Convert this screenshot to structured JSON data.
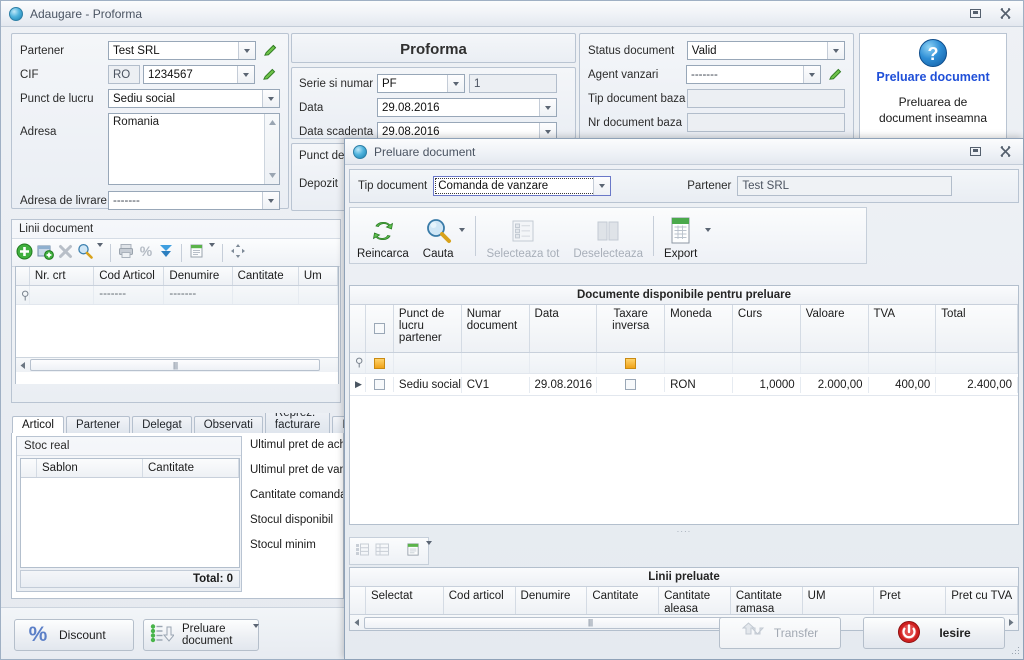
{
  "bg_window": {
    "title": "Adaugare - Proforma",
    "window_icon": "app-globe-icon",
    "restore_label": "restore-icon",
    "close_label": "close-icon",
    "partner_panel": {
      "fields": [
        {
          "label": "Partener",
          "value": "Test SRL",
          "type": "combo-edit"
        },
        {
          "label": "CIF",
          "prefix": "RO",
          "value": "1234567",
          "type": "combo-edit"
        },
        {
          "label": "Punct de lucru",
          "value": "Sediu social",
          "type": "combo"
        },
        {
          "label": "Adresa",
          "value": "Romania",
          "type": "textarea"
        },
        {
          "label": "Adresa de livrare",
          "value": "-------",
          "type": "combo"
        }
      ]
    },
    "doc_panel": {
      "title": "Proforma",
      "fields": [
        {
          "label": "Serie si numar",
          "value": "PF",
          "value2": "1",
          "type": "combo-plus-text"
        },
        {
          "label": "Data",
          "value": "29.08.2016",
          "type": "combo"
        },
        {
          "label": "Data scadenta",
          "value": "29.08.2016",
          "type": "combo"
        }
      ],
      "partial_fields": [
        {
          "label": "Punct de"
        },
        {
          "label": "Depozit"
        }
      ]
    },
    "status_panel": {
      "fields": [
        {
          "label": "Status document",
          "value": "Valid",
          "type": "combo"
        },
        {
          "label": "Agent vanzari",
          "value": "-------",
          "type": "combo-edit"
        },
        {
          "label": "Tip document baza",
          "value": "",
          "type": "readonly"
        },
        {
          "label": "Nr document baza",
          "value": "",
          "type": "readonly"
        }
      ]
    },
    "help_panel": {
      "icon": "question-mark-icon",
      "heading": "Preluare document",
      "body_line1": "Preluarea de",
      "body_line2": "document inseamna"
    },
    "lines_panel": {
      "caption": "Linii document",
      "toolbar_icons": [
        "add-icon",
        "add-from-icon",
        "delete-icon",
        "search-icon",
        "search-dropdown-caret",
        "print-icon",
        "percent-discount-icon",
        "collapse-icon",
        "report-icon",
        "report-dropdown-caret",
        "move-icon"
      ],
      "columns": [
        "Nr. crt",
        "Cod Articol",
        "Denumire",
        "Cantitate",
        "Um"
      ],
      "filter_row": [
        "",
        "-------",
        "-------",
        "",
        ""
      ],
      "scroll_thumb_glyph": "||||"
    },
    "detail_tabs": {
      "items": [
        "Articol",
        "Partener",
        "Delegat",
        "Observati",
        "Reprez. facturare",
        "In"
      ],
      "active": "Articol"
    },
    "stock_panel": {
      "caption": "Stoc real",
      "columns": [
        "Sablon",
        "Cantitate"
      ],
      "total_label": "Total: 0"
    },
    "stock_info_labels": [
      "Ultimul pret de achi:",
      "Ultimul pret de vanz",
      "Cantitate comanda",
      "Stocul disponibil",
      "Stocul minim"
    ],
    "footer_buttons": [
      {
        "label": "Discount",
        "icon": "percent-icon"
      },
      {
        "label": "Preluare document",
        "icon": "import-document-icon",
        "has_dropdown": true
      }
    ]
  },
  "modal": {
    "title": "Preluare document",
    "window_icon": "app-globe-icon",
    "restore_label": "restore-icon",
    "close_label": "close-icon",
    "header": {
      "doc_type_label": "Tip document",
      "doc_type_value": "Comanda de vanzare",
      "partner_label": "Partener",
      "partner_value": "Test SRL"
    },
    "toolbar": [
      {
        "label": "Reincarca",
        "icon": "refresh-icon",
        "disabled": false,
        "dropdown": false
      },
      {
        "label": "Cauta",
        "icon": "magnifier-icon",
        "disabled": false,
        "dropdown": true
      },
      {
        "label": "Selecteaza tot",
        "icon": "select-all-icon",
        "disabled": true,
        "dropdown": false
      },
      {
        "label": "Deselecteaza",
        "icon": "deselect-icon",
        "disabled": true,
        "dropdown": false
      },
      {
        "label": "Export",
        "icon": "excel-export-icon",
        "disabled": false,
        "dropdown": true
      }
    ],
    "available_grid": {
      "caption": "Documente disponibile pentru preluare",
      "columns": [
        "",
        "",
        "Punct de lucru partener",
        "Numar document",
        "Data",
        "Taxare inversa",
        "Moneda",
        "Curs",
        "Valoare",
        "TVA",
        "Total"
      ],
      "filter_row": {
        "indicator": "filter-pin-icon",
        "select_all_checkbox": "amber",
        "taxare_checkbox": "amber"
      },
      "rows": [
        {
          "indicator": "row-arrow-icon",
          "selected": false,
          "punct_lucru": "Sediu social",
          "numar_document": "CV1",
          "data": "29.08.2016",
          "taxare_inversa": false,
          "moneda": "RON",
          "curs": "1,0000",
          "valoare": "2.000,00",
          "tva": "400,00",
          "total": "2.400,00"
        }
      ]
    },
    "lines_toolbar_icons": [
      "expand-rows-icon",
      "collapse-rows-icon",
      "report-icon",
      "report-dropdown-caret"
    ],
    "taken_grid": {
      "caption": "Linii preluate",
      "columns": [
        "Selectat",
        "Cod articol",
        "Denumire",
        "Cantitate",
        "Cantitate aleasa",
        "Cantitate ramasa",
        "UM",
        "Pret",
        "Pret cu TVA"
      ],
      "rows": [],
      "scroll_thumb_glyph": "||||"
    },
    "footer_buttons": [
      {
        "label": "Transfer",
        "icon": "transfer-icon",
        "disabled": true
      },
      {
        "label": "Iesire",
        "icon": "power-icon",
        "disabled": false
      }
    ]
  },
  "colors": {
    "accent_blue": "#1f4fd8",
    "amber": "#f0a31a",
    "red": "#c9181b",
    "green": "#38a03a",
    "window_bg": "#eef1f5"
  }
}
